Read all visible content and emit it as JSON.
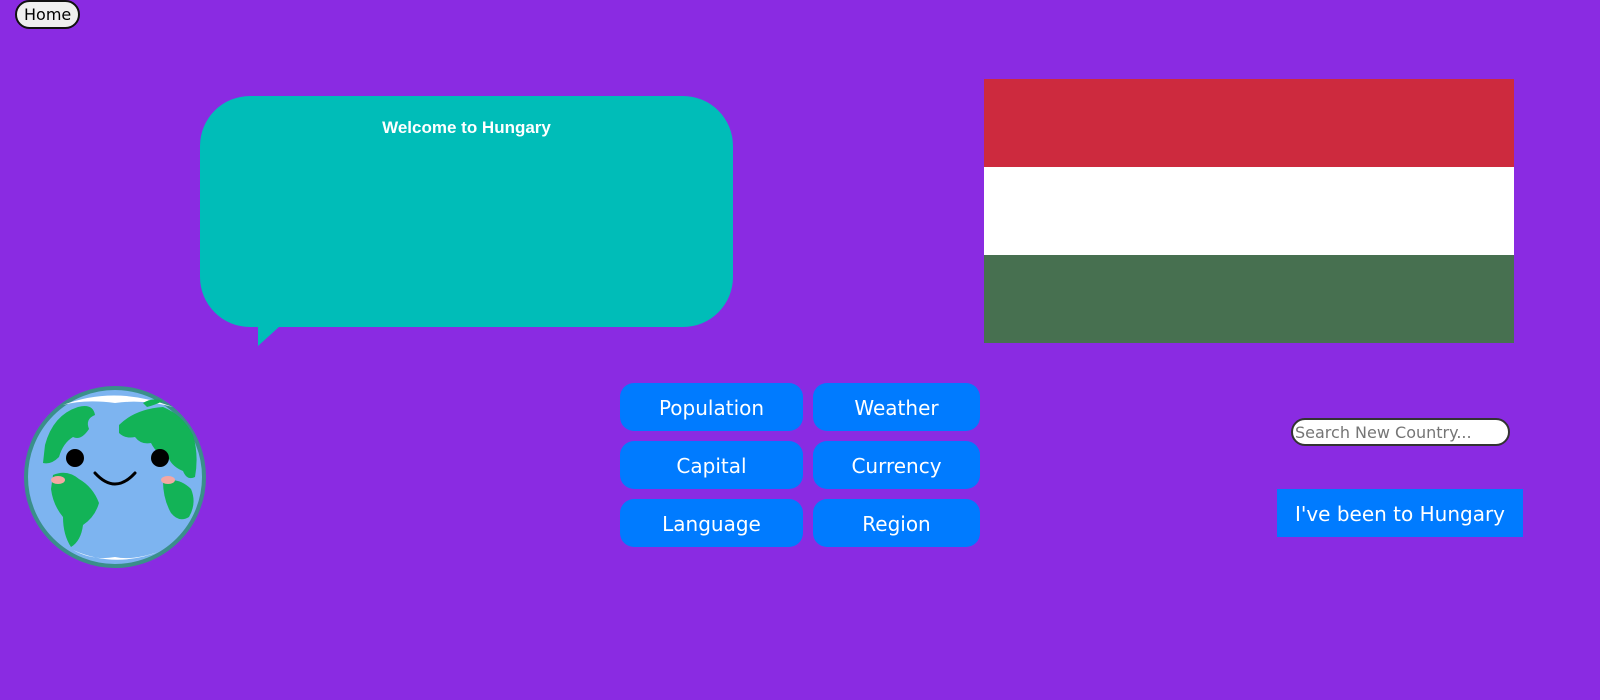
{
  "nav": {
    "home_label": "Home"
  },
  "bubble": {
    "title": "Welcome to Hungary"
  },
  "flag": {
    "country": "Hungary",
    "stripes": [
      "#cd2a3e",
      "#ffffff",
      "#477050"
    ]
  },
  "mascot": {
    "icon": "smiling-globe-icon"
  },
  "info_buttons": {
    "population": "Population",
    "weather": "Weather",
    "capital": "Capital",
    "currency": "Currency",
    "language": "Language",
    "region": "Region"
  },
  "search": {
    "placeholder": "Search New Country..."
  },
  "visited": {
    "label": "I've been to Hungary"
  },
  "colors": {
    "background": "#8a2be2",
    "bubble": "#00bdb8",
    "button": "#007bff"
  }
}
